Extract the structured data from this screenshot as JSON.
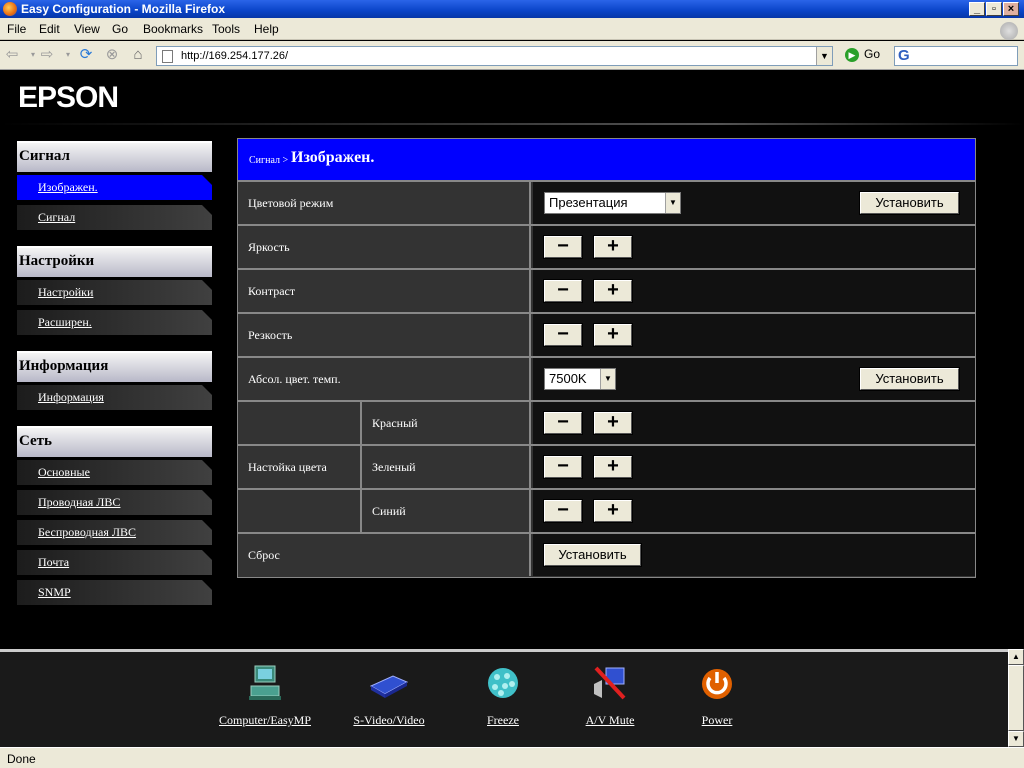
{
  "window": {
    "title": "Easy Configuration - Mozilla Firefox"
  },
  "menu": {
    "items": [
      "File",
      "Edit",
      "View",
      "Go",
      "Bookmarks",
      "Tools",
      "Help"
    ]
  },
  "toolbar": {
    "url": "http://169.254.177.26/",
    "go_label": "Go"
  },
  "brand": {
    "logo": "EPSON"
  },
  "sidebar": {
    "sections": [
      {
        "header": "Сигнал",
        "items": [
          "Изображен.",
          "Сигнал"
        ]
      },
      {
        "header": "Настройки",
        "items": [
          "Настройки",
          "Расширен."
        ]
      },
      {
        "header": "Информация",
        "items": [
          "Информация"
        ]
      },
      {
        "header": "Сеть",
        "items": [
          "Основные",
          "Проводная ЛВС",
          "Беспроводная ЛВС",
          "Почта",
          "SNMP"
        ]
      }
    ],
    "active_item": "Изображен."
  },
  "content": {
    "breadcrumb": "Сигнал >",
    "title": "Изображен.",
    "rows": {
      "color_mode": {
        "label": "Цветовой режим",
        "value": "Презентация",
        "button": "Установить"
      },
      "brightness": {
        "label": "Яркость"
      },
      "contrast": {
        "label": "Контраст"
      },
      "sharpness": {
        "label": "Резкость"
      },
      "abs_color_temp": {
        "label": "Абсол. цвет. темп.",
        "value": "7500K",
        "button": "Установить"
      },
      "color_adjust": {
        "label": "Настойка цвета",
        "red": "Красный",
        "green": "Зеленый",
        "blue": "Синий"
      },
      "reset": {
        "label": "Сброс",
        "button": "Установить"
      }
    },
    "minus": "−",
    "plus": "+"
  },
  "dock": [
    {
      "label": "Computer/EasyMP",
      "icon": "computer-icon"
    },
    {
      "label": "S-Video/Video",
      "icon": "video-icon"
    },
    {
      "label": "Freeze",
      "icon": "freeze-icon"
    },
    {
      "label": "A/V Mute",
      "icon": "av-mute-icon"
    },
    {
      "label": "Power",
      "icon": "power-icon"
    }
  ],
  "status": {
    "text": "Done"
  },
  "colors": {
    "accent": "#0000ff",
    "panel": "#333333",
    "control_bg": "#111111"
  }
}
